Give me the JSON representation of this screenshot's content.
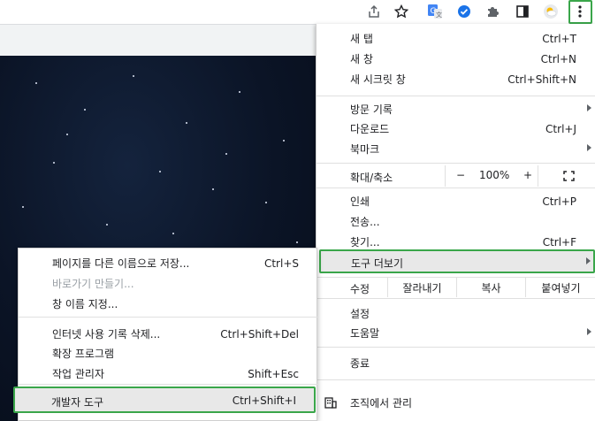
{
  "toolbar": {
    "icons": [
      "share-icon",
      "star-icon",
      "translate-extension-icon",
      "check-extension-icon",
      "puzzle-extensions-icon",
      "side-panel-icon",
      "weather-extension-icon",
      "more-menu-icon"
    ]
  },
  "menu": {
    "new_tab": {
      "label": "새 탭",
      "shortcut": "Ctrl+T"
    },
    "new_window": {
      "label": "새 창",
      "shortcut": "Ctrl+N"
    },
    "incognito": {
      "label": "새 시크릿 창",
      "shortcut": "Ctrl+Shift+N"
    },
    "history": {
      "label": "방문 기록"
    },
    "downloads": {
      "label": "다운로드",
      "shortcut": "Ctrl+J"
    },
    "bookmarks": {
      "label": "북마크"
    },
    "zoom": {
      "label": "확대/축소",
      "minus": "−",
      "value": "100%",
      "plus": "+"
    },
    "print": {
      "label": "인쇄",
      "shortcut": "Ctrl+P"
    },
    "cast": {
      "label": "전송..."
    },
    "find": {
      "label": "찾기...",
      "shortcut": "Ctrl+F"
    },
    "more_tools": {
      "label": "도구 더보기"
    },
    "edit": {
      "label": "수정",
      "cut": "잘라내기",
      "copy": "복사",
      "paste": "붙여넣기"
    },
    "settings": {
      "label": "설정"
    },
    "help": {
      "label": "도움말"
    },
    "exit": {
      "label": "종료"
    },
    "managed": {
      "label": "조직에서 관리"
    }
  },
  "submenu": {
    "save_page": {
      "label": "페이지를 다른 이름으로 저장...",
      "shortcut": "Ctrl+S"
    },
    "create_shortcut": {
      "label": "바로가기 만들기..."
    },
    "name_window": {
      "label": "창 이름 지정..."
    },
    "clear_data": {
      "label": "인터넷 사용 기록 삭제...",
      "shortcut": "Ctrl+Shift+Del"
    },
    "extensions": {
      "label": "확장 프로그램"
    },
    "task_manager": {
      "label": "작업 관리자",
      "shortcut": "Shift+Esc"
    },
    "dev_tools": {
      "label": "개발자 도구",
      "shortcut": "Ctrl+Shift+I"
    }
  },
  "colors": {
    "highlight_border": "#3aa64a",
    "hover_bg": "#e8e8e8"
  }
}
